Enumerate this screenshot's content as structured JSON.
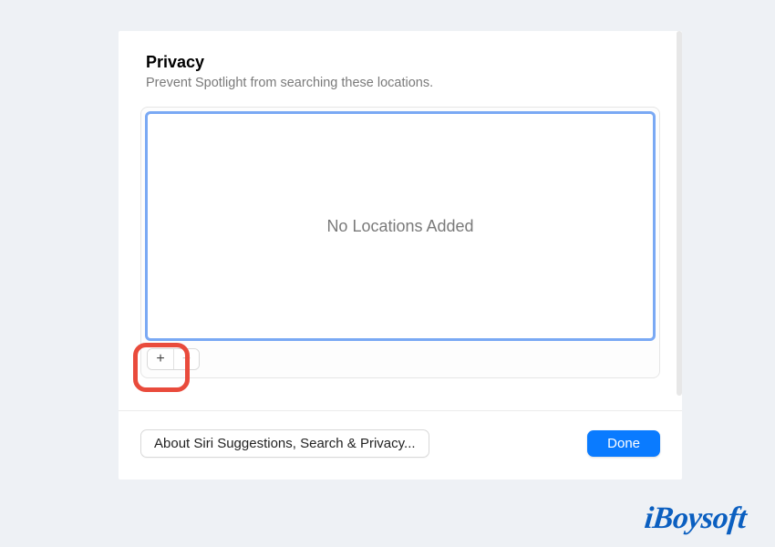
{
  "header": {
    "title": "Privacy",
    "subtitle": "Prevent Spotlight from searching these locations."
  },
  "list": {
    "empty_text": "No Locations Added",
    "add_label": "+",
    "remove_label": "−"
  },
  "footer": {
    "about_label": "About Siri Suggestions, Search & Privacy...",
    "done_label": "Done"
  },
  "watermark": "iBoysoft"
}
